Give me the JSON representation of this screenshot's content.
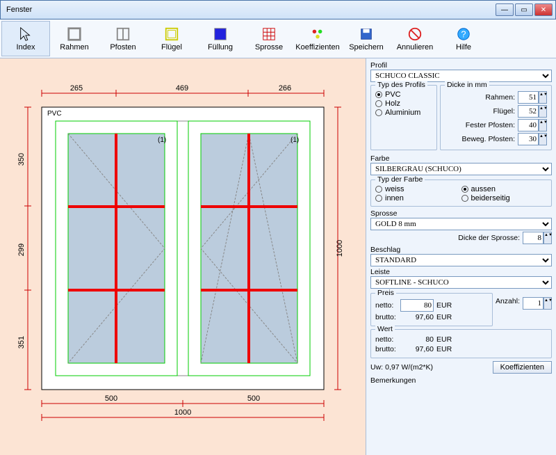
{
  "window": {
    "title": "Fenster"
  },
  "toolbar": [
    {
      "label": "Index",
      "icon": "cursor"
    },
    {
      "label": "Rahmen",
      "icon": "frame"
    },
    {
      "label": "Pfosten",
      "icon": "mullion"
    },
    {
      "label": "Flügel",
      "icon": "sash"
    },
    {
      "label": "Füllung",
      "icon": "fill"
    },
    {
      "label": "Sprosse",
      "icon": "grid"
    },
    {
      "label": "Koeffizienten",
      "icon": "coeff"
    },
    {
      "label": "Speichern",
      "icon": "save"
    },
    {
      "label": "Annulieren",
      "icon": "cancel"
    },
    {
      "label": "Hilfe",
      "icon": "help"
    }
  ],
  "drawing": {
    "material_tag": "PVC",
    "sash_tag_left": "(1)",
    "sash_tag_right": "(1)",
    "dims_top": [
      "265",
      "469",
      "266"
    ],
    "dims_left": [
      "350",
      "299",
      "351"
    ],
    "dim_right": "1000",
    "dims_bottom": [
      "500",
      "500"
    ],
    "dim_bottom_total": "1000"
  },
  "panel": {
    "profil_label": "Profil",
    "profil_value": "SCHUCO CLASSIC",
    "typ_profils_label": "Typ des Profils",
    "pvc": "PVC",
    "holz": "Holz",
    "aluminium": "Aluminium",
    "dicke_mm_label": "Dicke in mm",
    "rahmen_label": "Rahmen:",
    "rahmen_val": "51",
    "fluegel_label": "Flügel:",
    "fluegel_val": "52",
    "fester_label": "Fester Pfosten:",
    "fester_val": "40",
    "beweg_label": "Beweg. Pfosten:",
    "beweg_val": "30",
    "farbe_label": "Farbe",
    "farbe_value": "SILBERGRAU (SCHUCO)",
    "typ_farbe_label": "Typ der Farbe",
    "weiss": "weiss",
    "aussen": "aussen",
    "innen": "innen",
    "beider": "beiderseitig",
    "sprosse_label": "Sprosse",
    "sprosse_value": "GOLD 8 mm",
    "dicke_sprosse_label": "Dicke der Sprosse:",
    "dicke_sprosse_val": "8",
    "beschlag_label": "Beschlag",
    "beschlag_value": "STANDARD",
    "leiste_label": "Leiste",
    "leiste_value": "SOFTLINE - SCHUCO",
    "preis_label": "Preis",
    "netto_label": "netto:",
    "preis_netto": "80",
    "eur": "EUR",
    "brutto_label": "brutto:",
    "preis_brutto": "97,60",
    "anzahl_label": "Anzahl:",
    "anzahl_val": "1",
    "wert_label": "Wert",
    "wert_netto": "80",
    "wert_brutto": "97,60",
    "uw_label": "Uw:",
    "uw_val": "0,97 W/(m2*K)",
    "koeff_btn": "Koeffizienten",
    "bemerkungen_label": "Bemerkungen"
  }
}
